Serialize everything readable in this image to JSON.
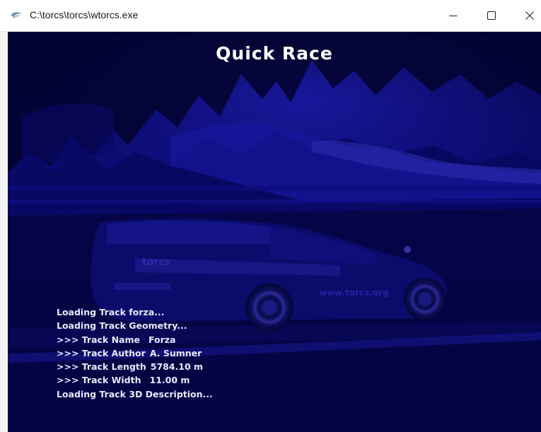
{
  "window": {
    "title": "C:\\torcs\\torcs\\wtorcs.exe",
    "app_icon": "torcs-app-icon",
    "controls": {
      "minimize_icon": "minimize-icon",
      "maximize_icon": "maximize-icon",
      "close_icon": "close-icon"
    }
  },
  "screen": {
    "title": "Quick Race",
    "background_tint": "#0a0a8c"
  },
  "loading_log": {
    "lines": [
      {
        "text": "Loading Track forza..."
      },
      {
        "text": "Loading Track Geometry..."
      },
      {
        "label": ">>> Track Name",
        "value": "Forza"
      },
      {
        "label": ">>> Track Author",
        "value": "A. Sumner"
      },
      {
        "label": ">>> Track Length",
        "value": "5784.10 m"
      },
      {
        "label": ">>> Track Width",
        "value": "11.00 m"
      },
      {
        "text": "Loading Track 3D Description..."
      }
    ]
  }
}
